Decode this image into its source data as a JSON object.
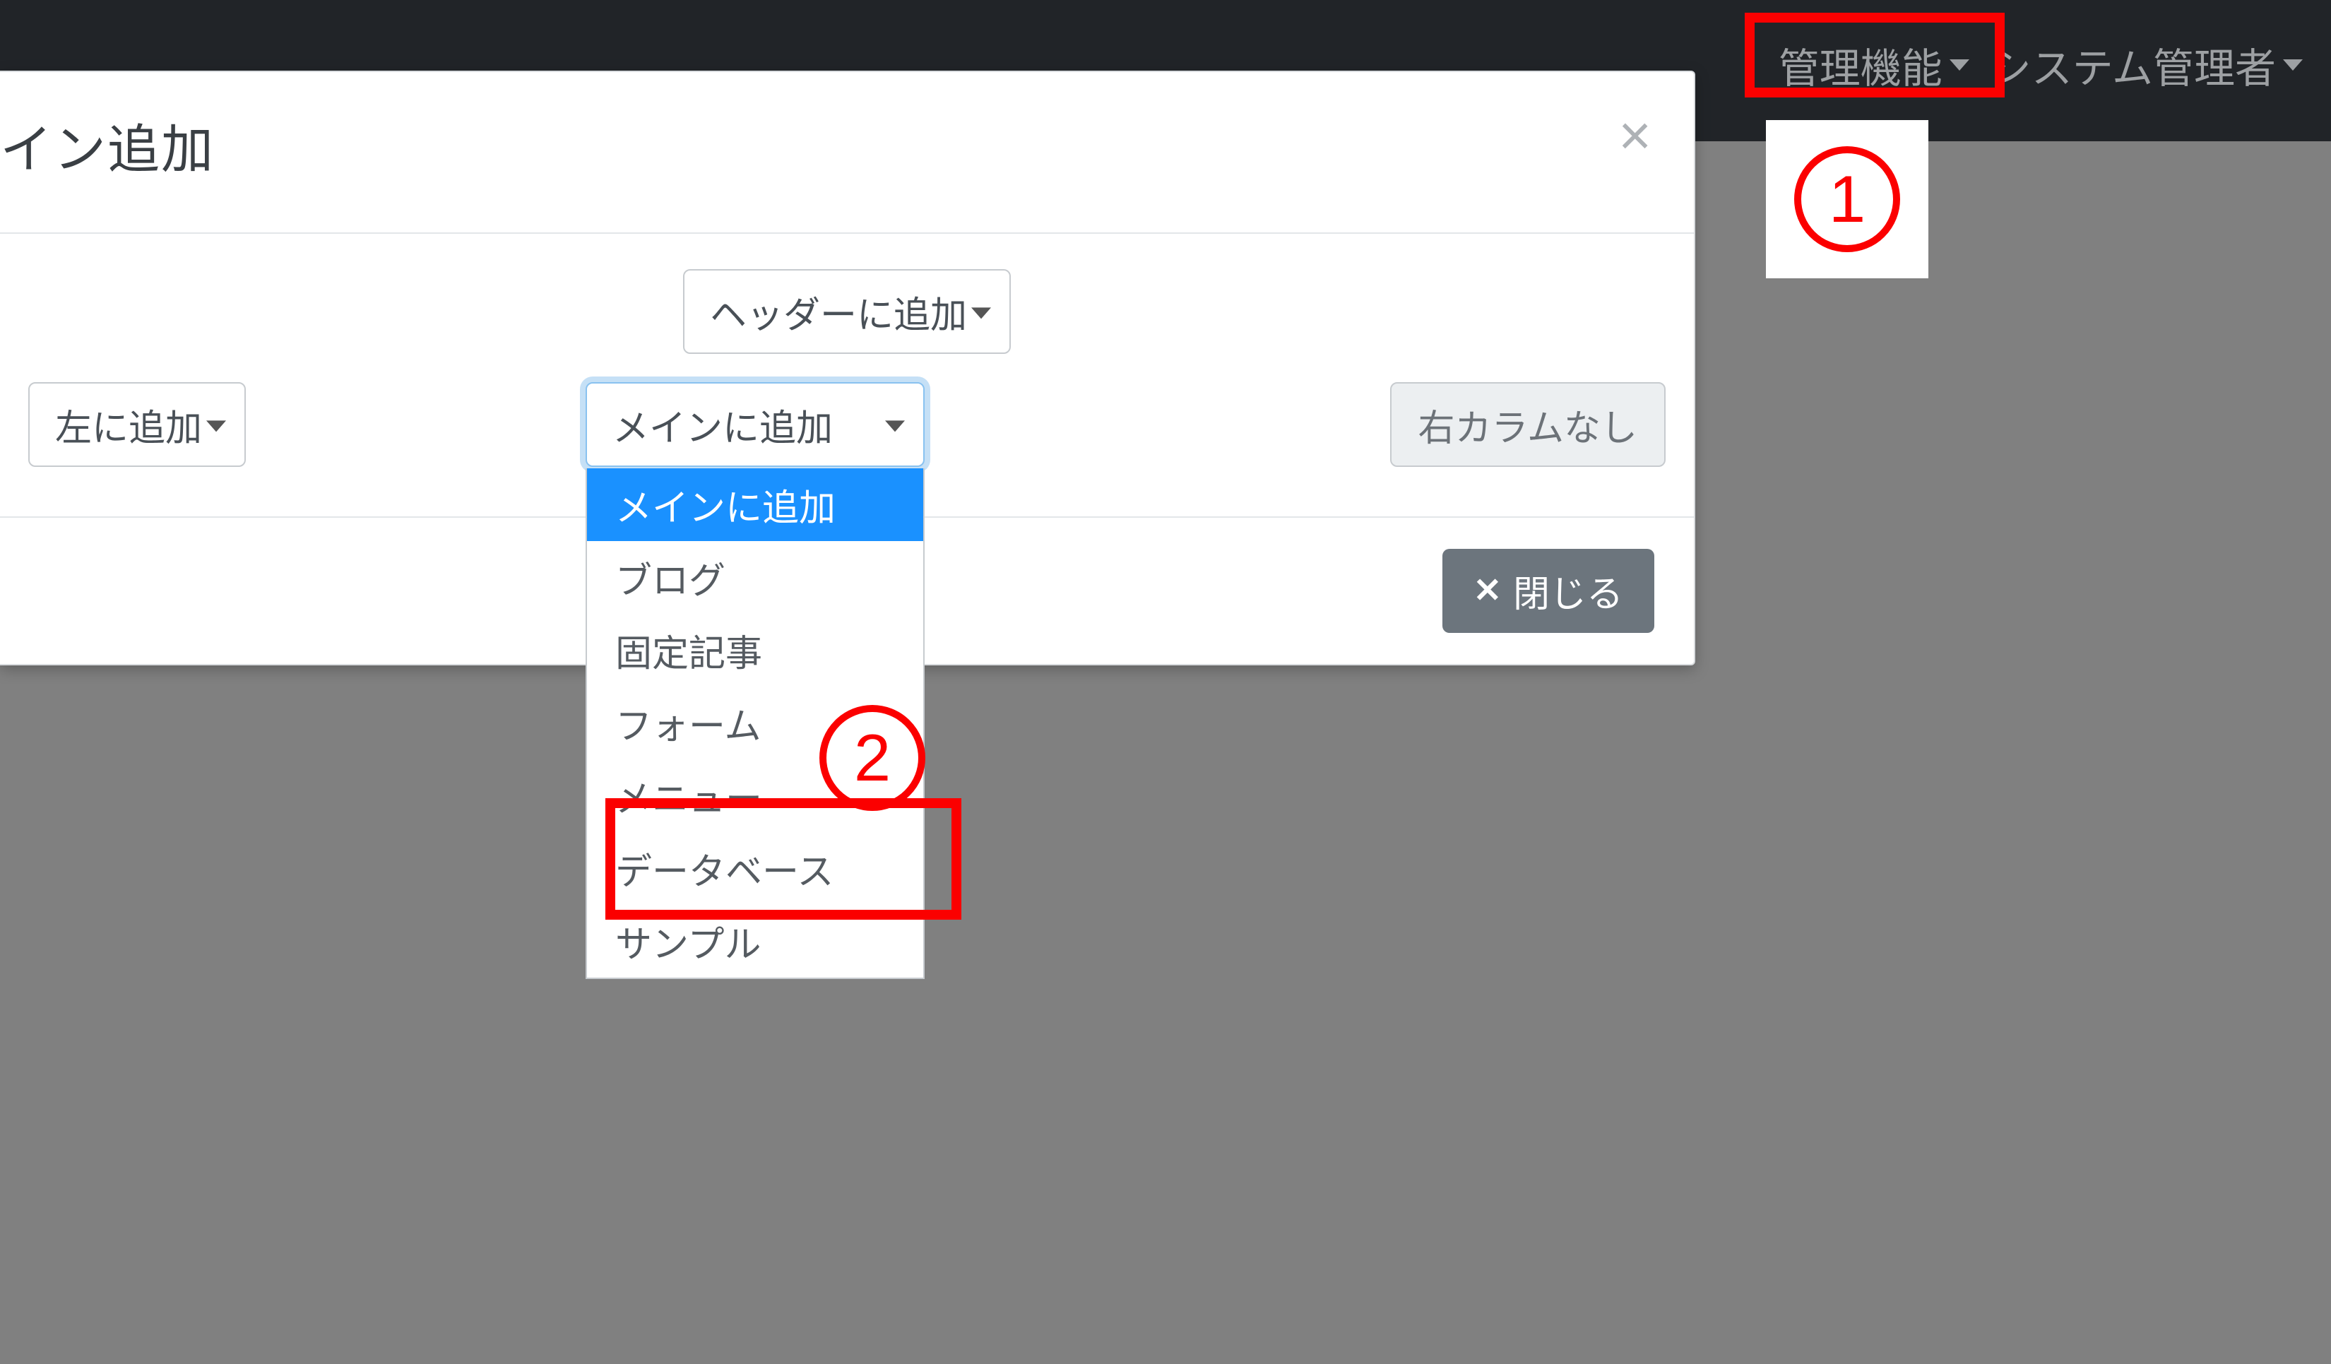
{
  "nav": {
    "admin_menu": "管理機能",
    "user_menu": "システム管理者"
  },
  "dialog": {
    "title": "イン追加",
    "close_x": "×",
    "header_select": "ヘッダーに追加",
    "left_select": "左に追加",
    "main_select": "メインに追加",
    "right_disabled": "右カラムなし",
    "options": {
      "0": "メインに追加",
      "1": "ブログ",
      "2": "固定記事",
      "3": "フォーム",
      "4": "メニュー",
      "5": "データベース",
      "6": "サンプル"
    },
    "footer": {
      "close_icon": "✕",
      "close_label": "閉じる"
    }
  },
  "annotations": {
    "badge1": "1",
    "badge2": "2"
  }
}
